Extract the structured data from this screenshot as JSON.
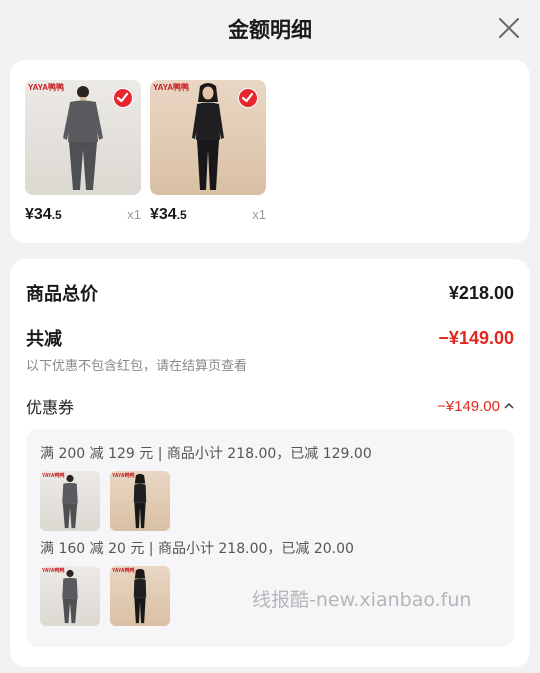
{
  "header": {
    "title": "金额明细",
    "close_icon": "close-icon"
  },
  "products": [
    {
      "brand": "YAYA鸭鸭",
      "price_main": "¥34",
      "price_decimal": ".5",
      "qty": "x1",
      "figure": "man-gray-thermal",
      "selected": true
    },
    {
      "brand": "YAYA鸭鸭",
      "price_main": "¥34",
      "price_decimal": ".5",
      "qty": "x1",
      "figure": "woman-black-thermal",
      "selected": true
    }
  ],
  "summary": {
    "total_label": "商品总价",
    "total_value": "¥218.00",
    "reduce_label": "共减",
    "reduce_value": "−¥149.00",
    "note": "以下优惠不包含红包，请在结算页查看",
    "coupon_label": "优惠券",
    "coupon_value": "−¥149.00",
    "coupon_toggle_icon": "chevron-up-icon"
  },
  "coupons": [
    {
      "text": "满 200 减 129 元 | 商品小计 218.00，已减 129.00"
    },
    {
      "text": "满 160 减 20 元 | 商品小计 218.00，已减 20.00"
    }
  ],
  "watermark": "线报酷-new.xianbao.fun",
  "colors": {
    "accent_red": "#e0281f",
    "check_red": "#e8262d",
    "brand_red": "#c8151b"
  }
}
